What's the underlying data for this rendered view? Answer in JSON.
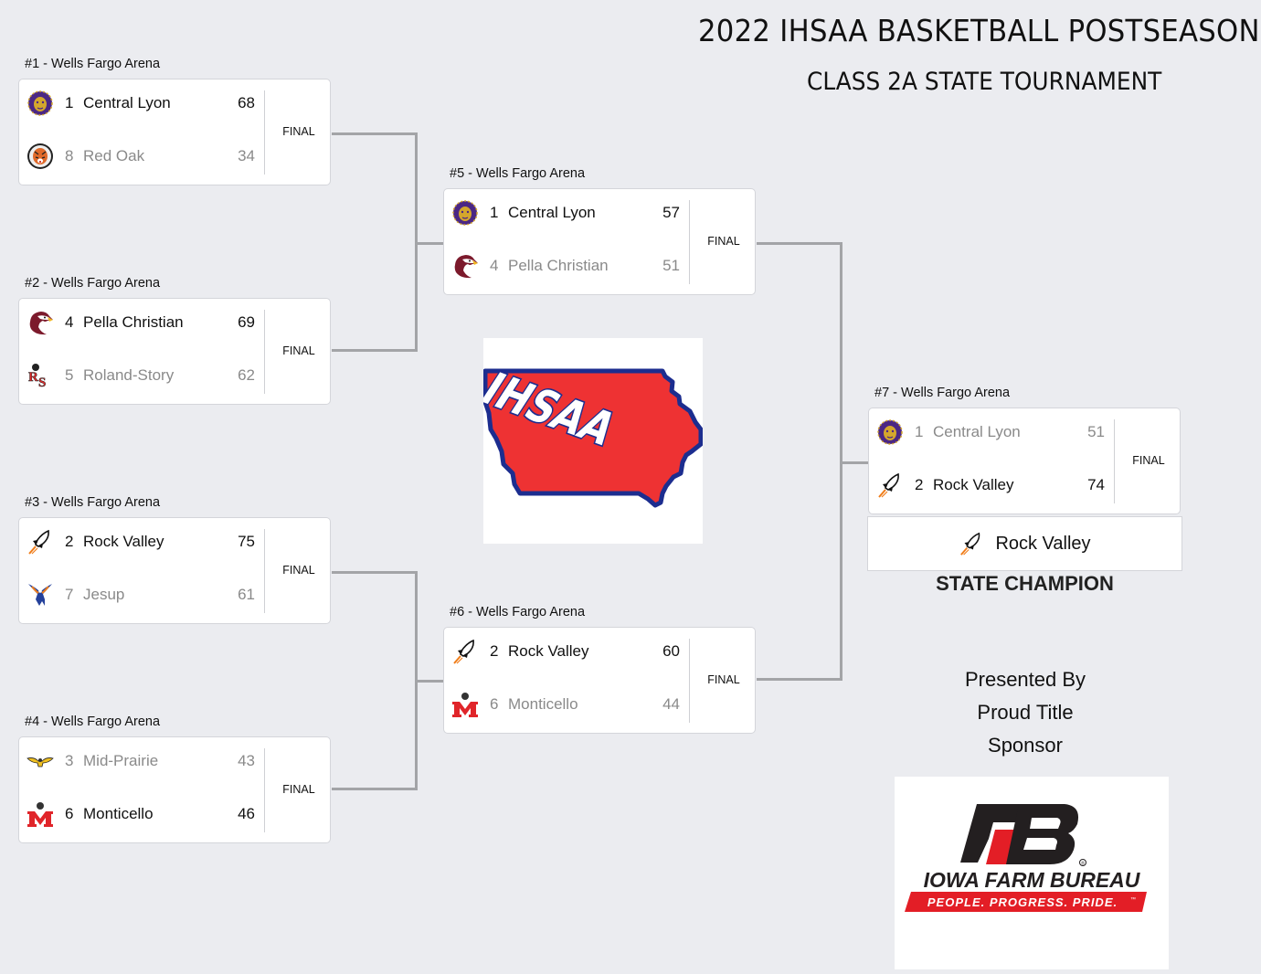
{
  "header": {
    "title": "2022 IHSAA BASKETBALL POSTSEASON",
    "subtitle": "CLASS 2A STATE TOURNAMENT"
  },
  "games": [
    {
      "label": "#1 - Wells Fargo Arena",
      "status": "FINAL",
      "teams": [
        {
          "seed": "1",
          "name": "Central Lyon",
          "score": "68",
          "logo": "lion-logo",
          "winner": true
        },
        {
          "seed": "8",
          "name": "Red Oak",
          "score": "34",
          "logo": "tiger-logo",
          "winner": false
        }
      ]
    },
    {
      "label": "#2 - Wells Fargo Arena",
      "status": "FINAL",
      "teams": [
        {
          "seed": "4",
          "name": "Pella Christian",
          "score": "69",
          "logo": "eagle-logo",
          "winner": true
        },
        {
          "seed": "5",
          "name": "Roland-Story",
          "score": "62",
          "logo": "rs-logo",
          "winner": false
        }
      ]
    },
    {
      "label": "#3 - Wells Fargo Arena",
      "status": "FINAL",
      "teams": [
        {
          "seed": "2",
          "name": "Rock Valley",
          "score": "75",
          "logo": "rocket-logo",
          "winner": true
        },
        {
          "seed": "7",
          "name": "Jesup",
          "score": "61",
          "logo": "hawk-logo",
          "winner": false
        }
      ]
    },
    {
      "label": "#4 - Wells Fargo Arena",
      "status": "FINAL",
      "teams": [
        {
          "seed": "3",
          "name": "Mid-Prairie",
          "score": "43",
          "logo": "golden-hawk-logo",
          "winner": false
        },
        {
          "seed": "6",
          "name": "Monticello",
          "score": "46",
          "logo": "m-logo",
          "winner": true
        }
      ]
    },
    {
      "label": "#5 - Wells Fargo Arena",
      "status": "FINAL",
      "teams": [
        {
          "seed": "1",
          "name": "Central Lyon",
          "score": "57",
          "logo": "lion-logo",
          "winner": true
        },
        {
          "seed": "4",
          "name": "Pella Christian",
          "score": "51",
          "logo": "eagle-logo",
          "winner": false
        }
      ]
    },
    {
      "label": "#6 - Wells Fargo Arena",
      "status": "FINAL",
      "teams": [
        {
          "seed": "2",
          "name": "Rock Valley",
          "score": "60",
          "logo": "rocket-logo",
          "winner": true
        },
        {
          "seed": "6",
          "name": "Monticello",
          "score": "44",
          "logo": "m-logo",
          "winner": false
        }
      ]
    },
    {
      "label": "#7 - Wells Fargo Arena",
      "status": "FINAL",
      "teams": [
        {
          "seed": "1",
          "name": "Central Lyon",
          "score": "51",
          "logo": "lion-logo",
          "winner": false
        },
        {
          "seed": "2",
          "name": "Rock Valley",
          "score": "74",
          "logo": "rocket-logo",
          "winner": true
        }
      ]
    }
  ],
  "champion": {
    "name": "Rock Valley",
    "label": "STATE CHAMPION"
  },
  "ihsaa_logo": {
    "text": "IHSAA"
  },
  "sponsor": {
    "lines": [
      "Presented By",
      "Proud Title",
      "Sponsor"
    ],
    "name": "IOWA FARM BUREAU",
    "tagline": "PEOPLE. PROGRESS. PRIDE.",
    "tm": "™",
    "reg": "®"
  },
  "colors": {
    "background": "#ebecf0",
    "connector": "#a3a4a7",
    "loser_text": "#8a8a8a",
    "ihsaa_red": "#ee3233",
    "ihsaa_blue": "#1c2d8f",
    "farm_bureau_red": "#e31e26"
  }
}
